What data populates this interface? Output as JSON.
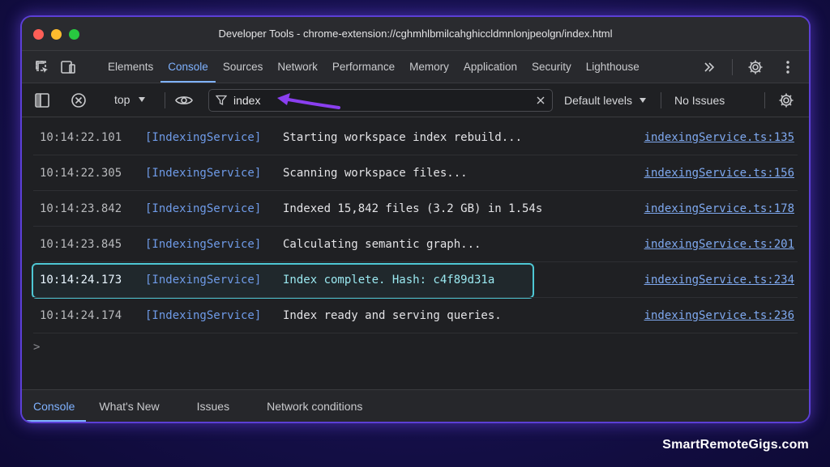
{
  "window": {
    "title": "Developer Tools - chrome-extension://cghmhlbmilcahghiccldmnlonjpeolgn/index.html"
  },
  "tabs": [
    {
      "label": "Elements"
    },
    {
      "label": "Console",
      "active": true
    },
    {
      "label": "Sources"
    },
    {
      "label": "Network"
    },
    {
      "label": "Performance"
    },
    {
      "label": "Memory"
    },
    {
      "label": "Application"
    },
    {
      "label": "Security"
    },
    {
      "label": "Lighthouse"
    }
  ],
  "toolbar": {
    "context": "top",
    "filter_value": "index",
    "levels": "Default levels",
    "issues": "No Issues"
  },
  "logs": [
    {
      "time": "10:14:22.101",
      "service": "[IndexingService]",
      "message": "Starting workspace index rebuild...",
      "source": "indexingService.ts:135"
    },
    {
      "time": "10:14:22.305",
      "service": "[IndexingService]",
      "message": "Scanning workspace files...",
      "source": "indexingService.ts:156"
    },
    {
      "time": "10:14:23.842",
      "service": "[IndexingService]",
      "message": "Indexed 15,842 files (3.2 GB) in 1.54s",
      "source": "indexingService.ts:178"
    },
    {
      "time": "10:14:23.845",
      "service": "[IndexingService]",
      "message": "Calculating semantic graph...",
      "source": "indexingService.ts:201"
    },
    {
      "time": "10:14:24.173",
      "service": "[IndexingService]",
      "message": "Index complete. Hash: c4f89d31a",
      "source": "indexingService.ts:234",
      "highlighted": true
    },
    {
      "time": "10:14:24.174",
      "service": "[IndexingService]",
      "message": "Index ready and serving queries.",
      "source": "indexingService.ts:236"
    }
  ],
  "prompt": ">",
  "drawer_tabs": [
    {
      "label": "Console",
      "active": true
    },
    {
      "label": "What's New"
    },
    {
      "label": "Issues"
    },
    {
      "label": "Network conditions"
    }
  ],
  "watermark": "SmartRemoteGigs.com",
  "colors": {
    "accent": "#7fb2ff",
    "highlight_border": "#4ec7d4",
    "annotation_arrow": "#8a3ff0",
    "frame_glow": "#5c3fd6"
  }
}
